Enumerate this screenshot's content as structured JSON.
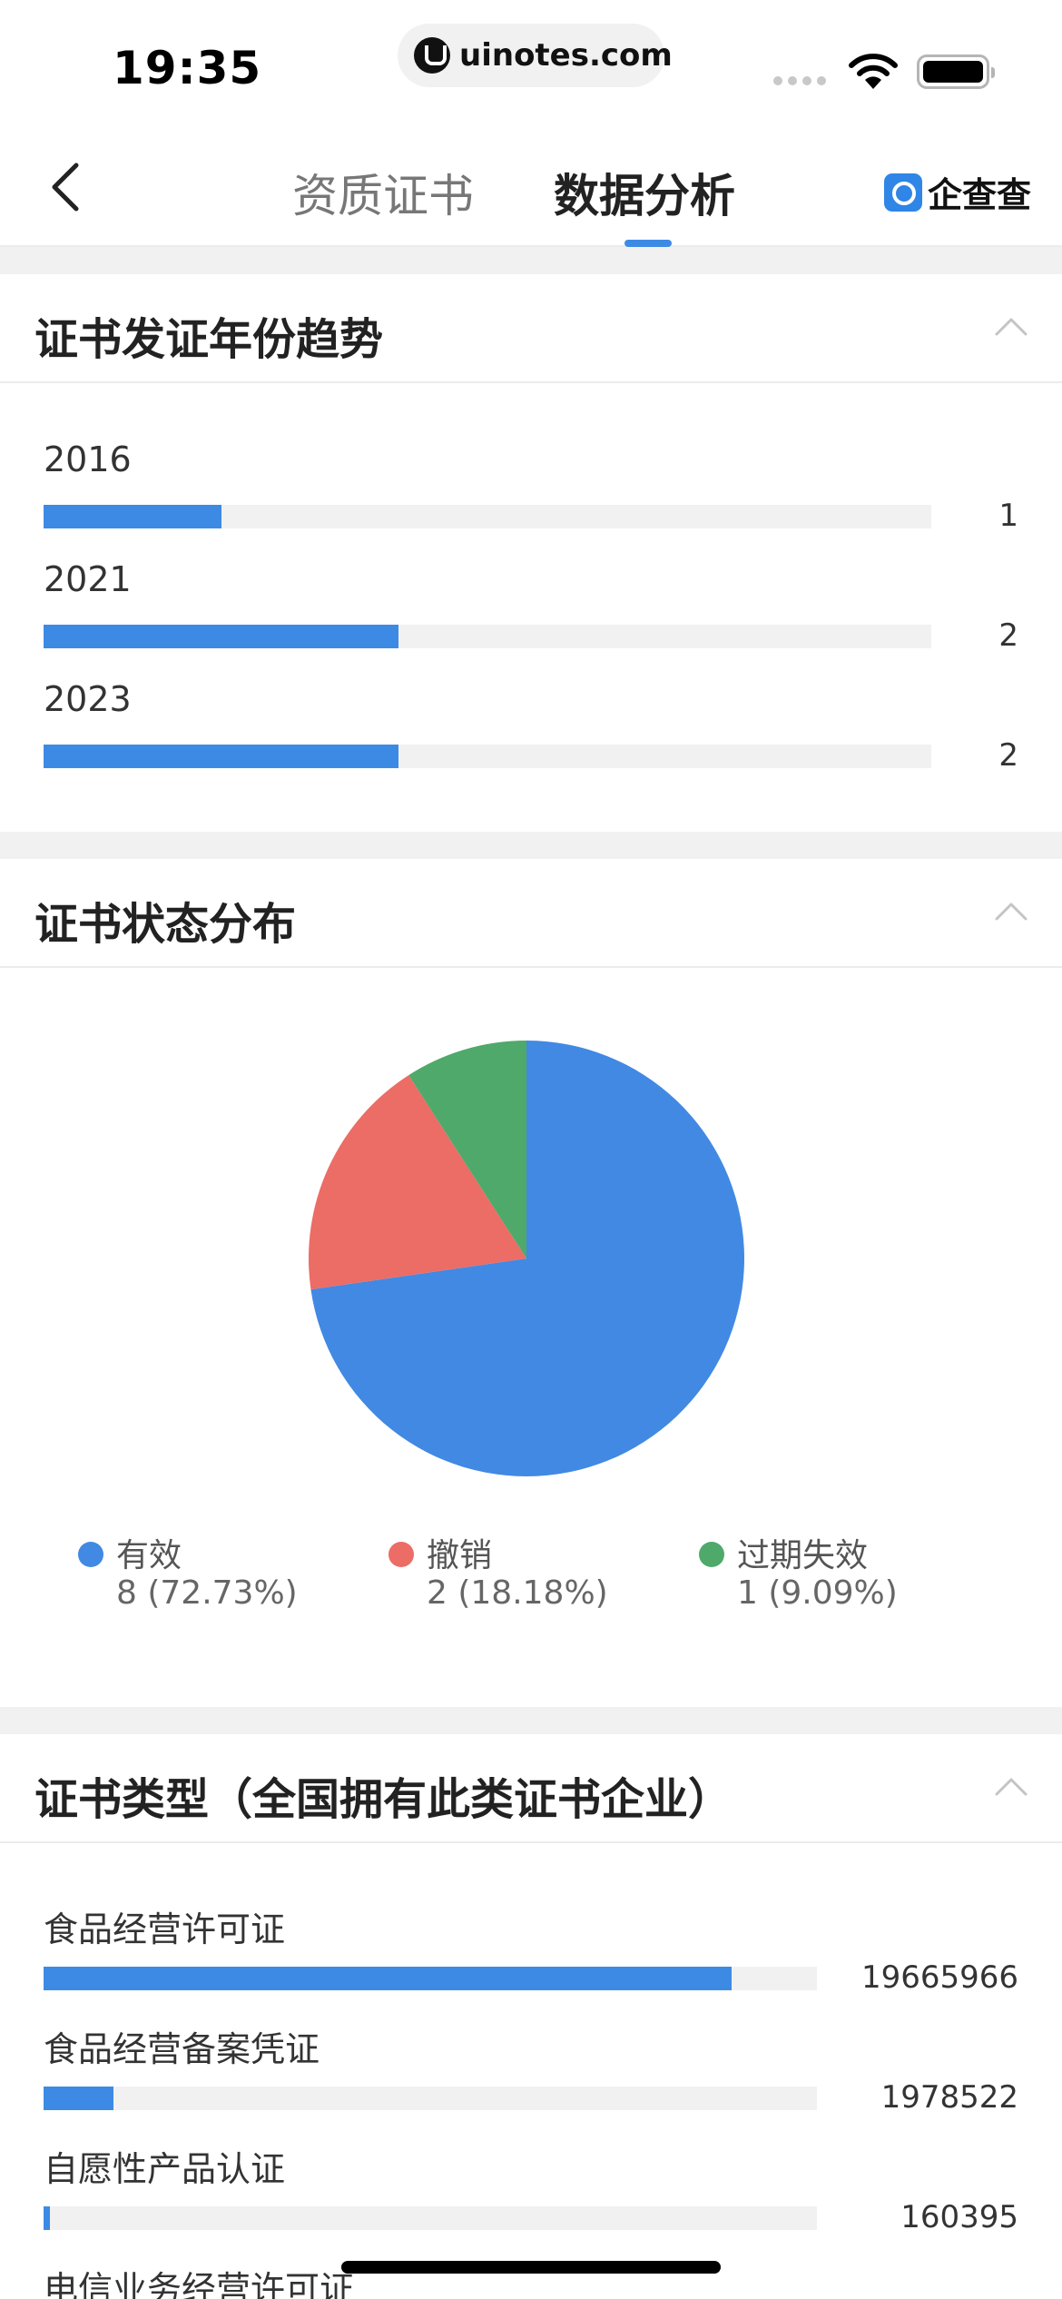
{
  "status_bar": {
    "time": "19:35",
    "url": "uinotes.com"
  },
  "nav": {
    "tabs": [
      {
        "label": "资质证书",
        "active": false
      },
      {
        "label": "数据分析",
        "active": true
      }
    ],
    "brand": "企查查",
    "accent_color": "#3d8ae5"
  },
  "section_year": {
    "title": "证书发证年份趋势",
    "rows": [
      {
        "label": "2016",
        "value": "1",
        "fraction": 0.2
      },
      {
        "label": "2021",
        "value": "2",
        "fraction": 0.4
      },
      {
        "label": "2023",
        "value": "2",
        "fraction": 0.4
      }
    ]
  },
  "section_status": {
    "title": "证书状态分布",
    "legend": [
      {
        "name": "有效",
        "value": "8 (72.73%)",
        "color": "#4189e3"
      },
      {
        "name": "撤销",
        "value": "2 (18.18%)",
        "color": "#ec6c66"
      },
      {
        "name": "过期失效",
        "value": "1 (9.09%)",
        "color": "#4fa96a"
      }
    ]
  },
  "section_type": {
    "title": "证书类型（全国拥有此类证书企业）",
    "rows": [
      {
        "label": "食品经营许可证",
        "value": "19665966",
        "fraction": 0.89
      },
      {
        "label": "食品经营备案凭证",
        "value": "1978522",
        "fraction": 0.09
      },
      {
        "label": "自愿性产品认证",
        "value": "160395",
        "fraction": 0.008
      },
      {
        "label": "电信业务经营许可证",
        "value": "",
        "fraction": 0
      }
    ]
  },
  "chart_data": {
    "type": "pie",
    "title": "证书状态分布",
    "categories": [
      "有效",
      "撤销",
      "过期失效"
    ],
    "values": [
      8,
      2,
      1
    ],
    "percentages": [
      72.73,
      18.18,
      9.09
    ],
    "colors": [
      "#4189e3",
      "#ec6c66",
      "#4fa96a"
    ],
    "legend": "bottom"
  }
}
